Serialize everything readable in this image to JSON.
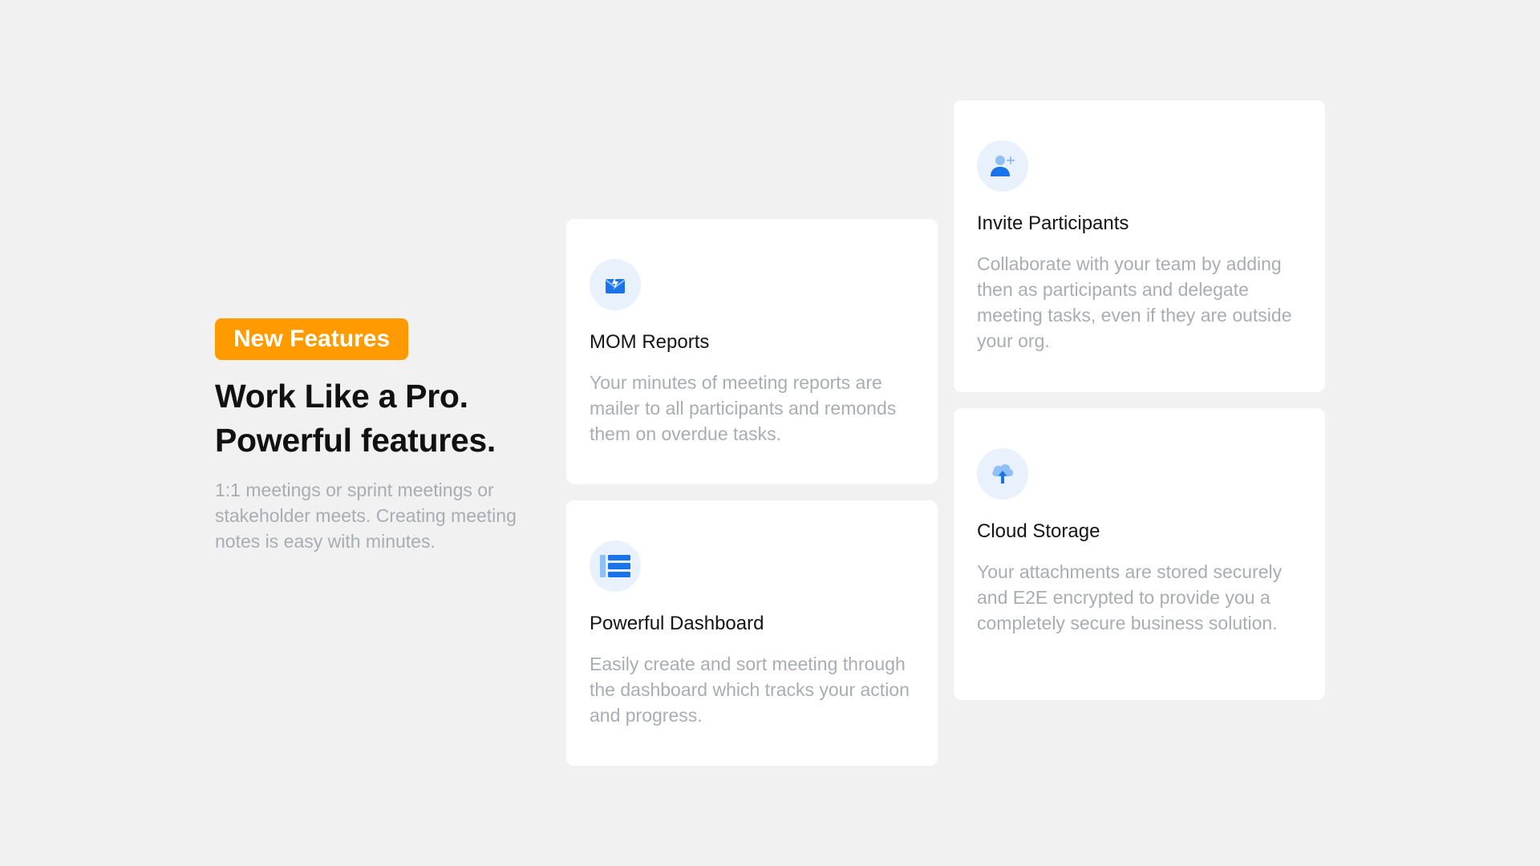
{
  "intro": {
    "badge": "New Features",
    "headline_line1": "Work Like a Pro.",
    "headline_line2": "Powerful features.",
    "description": "1:1 meetings or sprint meetings or stakeholder meets. Creating meeting notes is easy with minutes."
  },
  "colors": {
    "badge_bg": "#ff9b00",
    "icon_primary": "#1a73e8",
    "icon_circle_bg": "#e8f1fc",
    "muted_text": "#a9adb3"
  },
  "cards": [
    {
      "icon": "mail-report-icon",
      "title": "MOM Reports",
      "description": "Your minutes of meeting reports are mailer to all participants and remonds them on overdue tasks."
    },
    {
      "icon": "dashboard-list-icon",
      "title": "Powerful Dashboard",
      "description": "Easily create and sort meeting through the dashboard which tracks your action and progress."
    },
    {
      "icon": "add-user-icon",
      "title": "Invite Participants",
      "description": "Collaborate with your team by adding then as participants and delegate meeting tasks, even if they are outside your org."
    },
    {
      "icon": "cloud-upload-icon",
      "title": "Cloud Storage",
      "description": "Your attachments are stored securely and E2E encrypted to provide you a completely secure business solution."
    }
  ]
}
